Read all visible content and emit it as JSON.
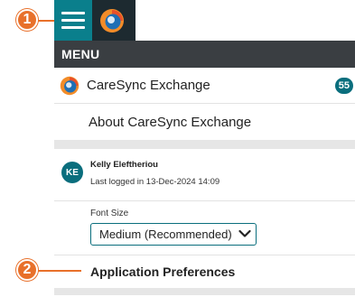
{
  "callouts": {
    "one": "1",
    "two": "2"
  },
  "menu": {
    "header": "MENU",
    "exchange": {
      "label": "CareSync Exchange",
      "badge": "55"
    },
    "about_label": "About CareSync Exchange",
    "user": {
      "initials": "KE",
      "name": "Kelly Eleftheriou",
      "last_login": "Last logged in 13-Dec-2024 14:09"
    },
    "font_size": {
      "label": "Font Size",
      "selected": "Medium (Recommended)"
    },
    "preferences_label": "Application Preferences"
  },
  "icons": {
    "menu": "hamburger-icon",
    "logo": "caresync-logo-icon",
    "dropdown": "chevron-down-icon"
  },
  "colors": {
    "accent": "#0a7f8c",
    "callout": "#e8702a",
    "header_bg": "#3a3e42",
    "topbar_bg": "#1d2a30",
    "badge_bg": "#0a6e7d"
  }
}
